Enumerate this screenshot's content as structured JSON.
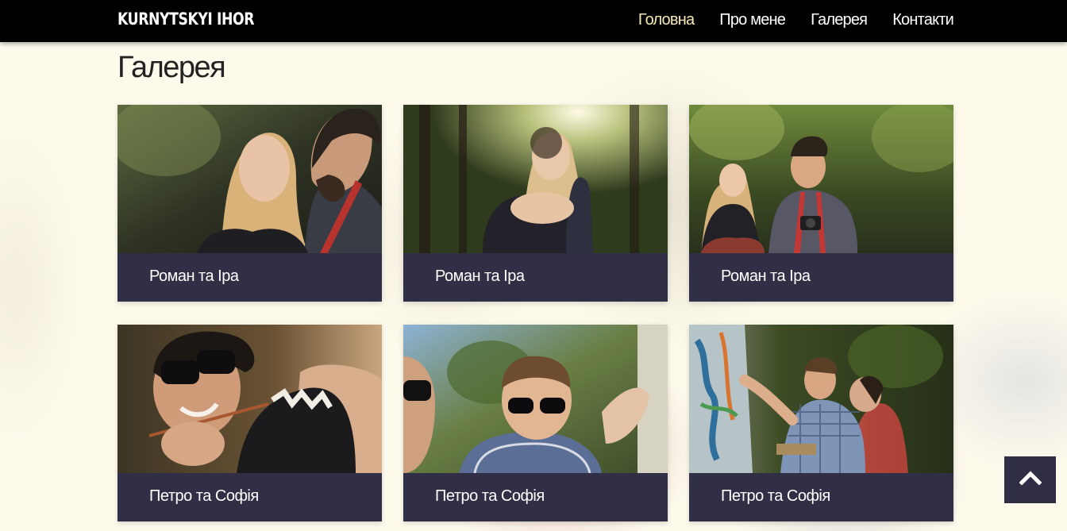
{
  "navbar": {
    "brand": "KURNYTSKYI IHOR",
    "links": [
      {
        "label": "Головна",
        "active": true
      },
      {
        "label": "Про мене",
        "active": false
      },
      {
        "label": "Галерея",
        "active": false
      },
      {
        "label": "Контакти",
        "active": false
      }
    ],
    "active_color": "#f4e9b2"
  },
  "page": {
    "title": "Галерея"
  },
  "gallery": {
    "cards": [
      {
        "caption": "Роман та Іра",
        "photo": "couple-embrace-photo"
      },
      {
        "caption": "Роман та Іра",
        "photo": "couple-forest-sunlight-photo"
      },
      {
        "caption": "Роман та Іра",
        "photo": "couple-holding-hands-photo"
      },
      {
        "caption": "Петро та Софія",
        "photo": "woman-sunglasses-painting-photo"
      },
      {
        "caption": "Петро та Софія",
        "photo": "man-sunglasses-painting-photo"
      },
      {
        "caption": "Петро та Софія",
        "photo": "couple-painting-wall-photo"
      }
    ],
    "caption_bg": "#312f46"
  },
  "scroll_top": {
    "icon": "chevron-up-icon"
  }
}
